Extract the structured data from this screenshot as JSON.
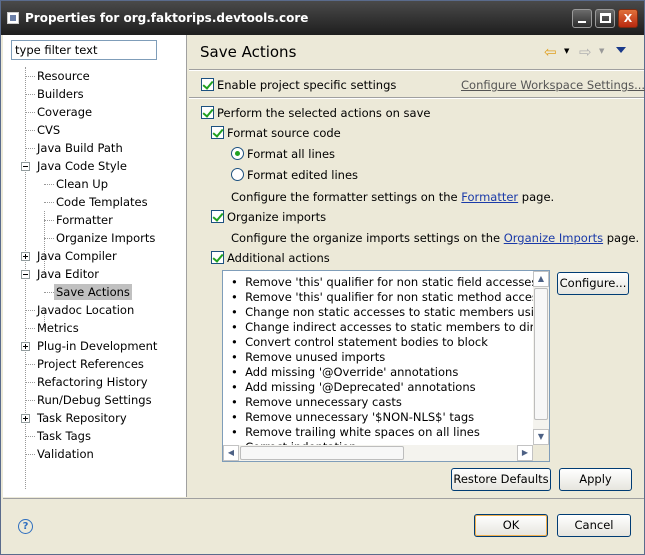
{
  "window": {
    "title": "Properties for org.faktorips.devtools.core"
  },
  "filter": {
    "value": "type filter text"
  },
  "tree": {
    "items": [
      "Resource",
      "Builders",
      "Coverage",
      "CVS",
      "Java Build Path",
      "Java Code Style",
      "Clean Up",
      "Code Templates",
      "Formatter",
      "Organize Imports",
      "Java Compiler",
      "Java Editor",
      "Save Actions",
      "Javadoc Location",
      "Metrics",
      "Plug-in Development",
      "Project References",
      "Refactoring History",
      "Run/Debug Settings",
      "Task Repository",
      "Task Tags",
      "Validation"
    ]
  },
  "page": {
    "title": "Save Actions",
    "enable_project_settings": "Enable project specific settings",
    "configure_workspace_link": "Configure Workspace Settings...",
    "perform_selected": "Perform the selected actions on save",
    "format_source": "Format source code",
    "format_all": "Format all lines",
    "format_edited": "Format edited lines",
    "formatter_prefix": "Configure the formatter settings on the",
    "formatter_link": "Formatter",
    "formatter_suffix": "page.",
    "organize_imports": "Organize imports",
    "organize_prefix": "Configure the organize imports settings on the",
    "organize_link": "Organize Imports",
    "organize_suffix": "page.",
    "additional_actions": "Additional actions",
    "actions": [
      "Remove 'this' qualifier for non static field accesses",
      "Remove 'this' qualifier for non static method accesses",
      "Change non static accesses to static members using",
      "Change indirect accesses to static members to direct",
      "Convert control statement bodies to block",
      "Remove unused imports",
      "Add missing '@Override' annotations",
      "Add missing '@Deprecated' annotations",
      "Remove unnecessary casts",
      "Remove unnecessary '$NON-NLS$' tags",
      "Remove trailing white spaces on all lines",
      "Correct indentation"
    ],
    "configure_button": "Configure...",
    "restore_defaults": "Restore Defaults",
    "apply": "Apply"
  },
  "footer": {
    "ok": "OK",
    "cancel": "Cancel"
  },
  "icons": {
    "help": "?",
    "minimize": "minimize-icon",
    "maximize": "maximize-icon",
    "close": "X"
  }
}
